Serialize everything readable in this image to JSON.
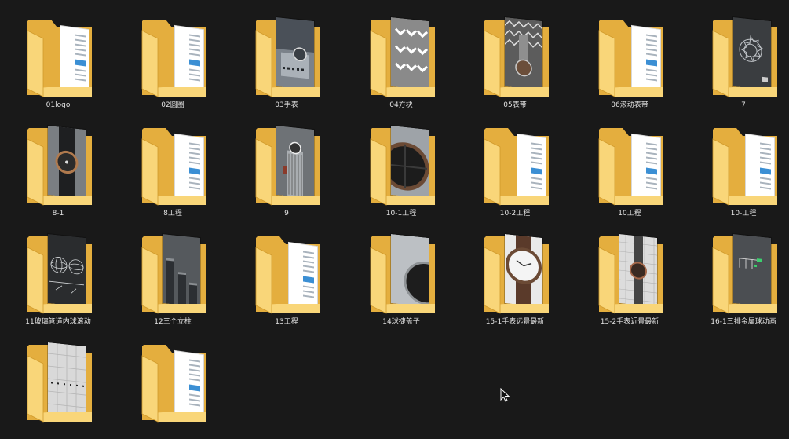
{
  "window": {
    "background": "#191919"
  },
  "colors": {
    "folder_back": "#e4ae3e",
    "folder_front": "#f9d679",
    "folder_edge": "#d09a2c",
    "label": "#e2e2e2"
  },
  "items": [
    {
      "label": "01logo",
      "thumb": "doc"
    },
    {
      "label": "02圆圈",
      "thumb": "doc"
    },
    {
      "label": "03手表",
      "thumb": "watch-closeup"
    },
    {
      "label": "04方块",
      "thumb": "chevrons"
    },
    {
      "label": "05表带",
      "thumb": "strap"
    },
    {
      "label": "06滚动表带",
      "thumb": "doc"
    },
    {
      "label": "7",
      "thumb": "dark-dial"
    },
    {
      "label": "8-1",
      "thumb": "watch-side"
    },
    {
      "label": "8工程",
      "thumb": "doc"
    },
    {
      "label": "9",
      "thumb": "tower-watch"
    },
    {
      "label": "10-1工程",
      "thumb": "dark-wheel"
    },
    {
      "label": "10-2工程",
      "thumb": "doc"
    },
    {
      "label": "10工程",
      "thumb": "doc"
    },
    {
      "label": "10-工程",
      "thumb": "doc"
    },
    {
      "label": "11玻璃管道内球滚动",
      "thumb": "wireframe"
    },
    {
      "label": "12三个立柱",
      "thumb": "pillars"
    },
    {
      "label": "13工程",
      "thumb": "doc"
    },
    {
      "label": "14球捷盖子",
      "thumb": "lid"
    },
    {
      "label": "15-1手表远景最新",
      "thumb": "big-watch"
    },
    {
      "label": "15-2手表近景最新",
      "thumb": "grid-watch"
    },
    {
      "label": "16-1三排金属球动画",
      "thumb": "balls"
    },
    {
      "label": "",
      "thumb": "tiles"
    },
    {
      "label": "",
      "thumb": "doc"
    }
  ]
}
